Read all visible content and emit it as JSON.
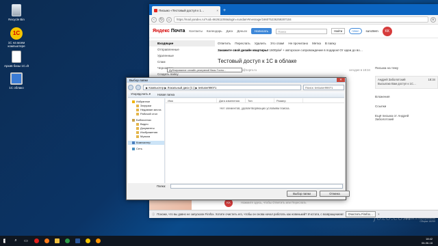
{
  "desktop": {
    "icons": [
      {
        "label": "Recycle Bin"
      },
      {
        "label": "1С на моем компьютере"
      },
      {
        "label": "Архив базы 1С.dt"
      },
      {
        "label": "1С облако"
      }
    ]
  },
  "browser": {
    "tab_title": "Письмо «Тестовый доступ к 1…",
    "url": "https://mail.yandex.ru/?uid=662611055&login=sundam#message/166075236259287104"
  },
  "mail": {
    "logo_ya": "Яндекс",
    "logo_rest": "Почта",
    "nav": [
      "Контакты",
      "Календарь",
      "Диск",
      "Деньги"
    ],
    "compose": "Написать",
    "search_placeholder": "Поиск",
    "find": "Найти",
    "plus": "плюс",
    "user": "sunc9em",
    "avatar": "KK",
    "folders": [
      {
        "label": "Входящие",
        "active": true
      },
      {
        "label": "Отправленные"
      },
      {
        "label": "Удаленные"
      },
      {
        "label": "Спам"
      },
      {
        "label": "Черновики"
      },
      {
        "label": "Создать папку"
      }
    ],
    "toolbar": [
      "Ответить",
      "Переслать",
      "Удалить",
      "Это спам!",
      "Не прочитано",
      "Метка",
      "В папку"
    ],
    "ad_bold": "Закажите свой дизайн квартиры!",
    "ad_rest": " 1600р/м² + авторское сопровождение в подарок! От идеи до во…",
    "subject": "Тестовый доступ к 1С в облаке",
    "from": "info@1cpro.ru",
    "date": "сегодня в 18:34",
    "right": {
      "on_topic": "Письма на тему",
      "card_name": "Андрей Заболотский",
      "card_time": "18:34",
      "card_text": "Высылаю Вам доступ к 1С…",
      "attachments": "Вложения",
      "links": "Ссылки",
      "more_from_1": "Ещё письма от Андрей",
      "more_from_2": "Заболотский"
    },
    "reply_hint": "Нажмите здесь, чтобы Ответить или Переслать",
    "reply_avatar": "KK"
  },
  "notification": {
    "text": "Похоже, что вы давно не запускали Firefox. Хотите очистить его, чтобы он снова начал работать как новенький? И кстати, с возвращением!",
    "button": "Очистить Firefox…"
  },
  "tooltip": "Дублирование онлайн-резервной базы Госты...",
  "dialog": {
    "title": "Выбор папки",
    "close": "✕",
    "path": "▶ Компьютер ▶ Локальный диск (C:) ▶ testuser99071",
    "search_placeholder": "Поиск: testuser99071",
    "toolbar": [
      "Упорядочить ▾",
      "Новая папка"
    ],
    "tree": [
      {
        "label": "Избранное",
        "child": false
      },
      {
        "label": "Загрузки",
        "child": true
      },
      {
        "label": "Недавние места",
        "child": true
      },
      {
        "label": "Рабочий стол",
        "child": true
      },
      {
        "label": "",
        "gap": true
      },
      {
        "label": "Библиотеки",
        "child": false
      },
      {
        "label": "Видео",
        "child": true
      },
      {
        "label": "Документы",
        "child": true
      },
      {
        "label": "Изображения",
        "child": true
      },
      {
        "label": "Музыка",
        "child": true
      },
      {
        "label": "",
        "gap": true
      },
      {
        "label": "Компьютер",
        "child": false,
        "selected": true
      },
      {
        "label": "",
        "gap": true
      },
      {
        "label": "Сеть",
        "child": false
      }
    ],
    "columns": [
      "Имя",
      "Дата изменения",
      "Тип",
      "Размер"
    ],
    "empty": "Нет элементов, удовлетворяющих условиям поиска.",
    "folder_label": "Папка:",
    "folder_value": "",
    "ok": "Выбор папки",
    "cancel": "Отмена"
  },
  "tray": {
    "time": "18:42",
    "date": "06-06-18"
  },
  "watermark": "fozo.com",
  "win_ver_1": "Windows 10 Корпоративная",
  "win_ver_2": "Сборка 16299"
}
